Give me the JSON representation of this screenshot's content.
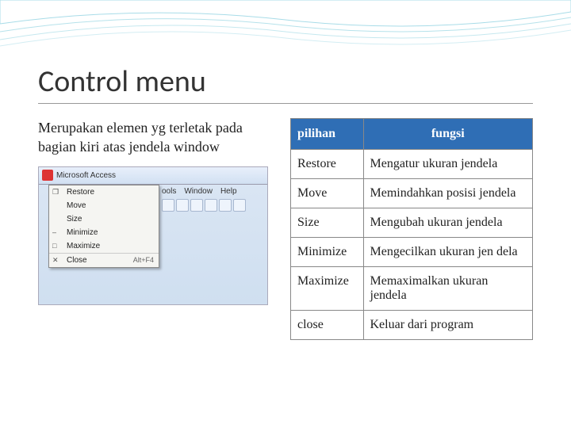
{
  "title": "Control menu",
  "description": "Merupakan elemen yg terletak pada bagian kiri atas jendela window",
  "screenshot": {
    "app_title": "Microsoft Access",
    "menubar": [
      "ools",
      "Window",
      "Help"
    ],
    "menu_items": [
      {
        "sym": "❐",
        "label": "Restore",
        "right": ""
      },
      {
        "sym": "",
        "label": "Move",
        "right": ""
      },
      {
        "sym": "",
        "label": "Size",
        "right": ""
      },
      {
        "sym": "–",
        "label": "Minimize",
        "right": ""
      },
      {
        "sym": "□",
        "label": "Maximize",
        "right": ""
      },
      {
        "sym": "✕",
        "label": "Close",
        "right": "Alt+F4",
        "sep": true
      }
    ]
  },
  "table": {
    "headers": [
      "pilihan",
      "fungsi"
    ],
    "rows": [
      [
        "Restore",
        "Mengatur ukuran jendela"
      ],
      [
        "Move",
        "Memindahkan posisi jendela"
      ],
      [
        "Size",
        "Mengubah ukuran jendela"
      ],
      [
        "Minimize",
        "Mengecilkan ukuran jen dela"
      ],
      [
        "Maximize",
        "Memaximalkan ukuran jendela"
      ],
      [
        "close",
        "Keluar dari program"
      ]
    ]
  }
}
